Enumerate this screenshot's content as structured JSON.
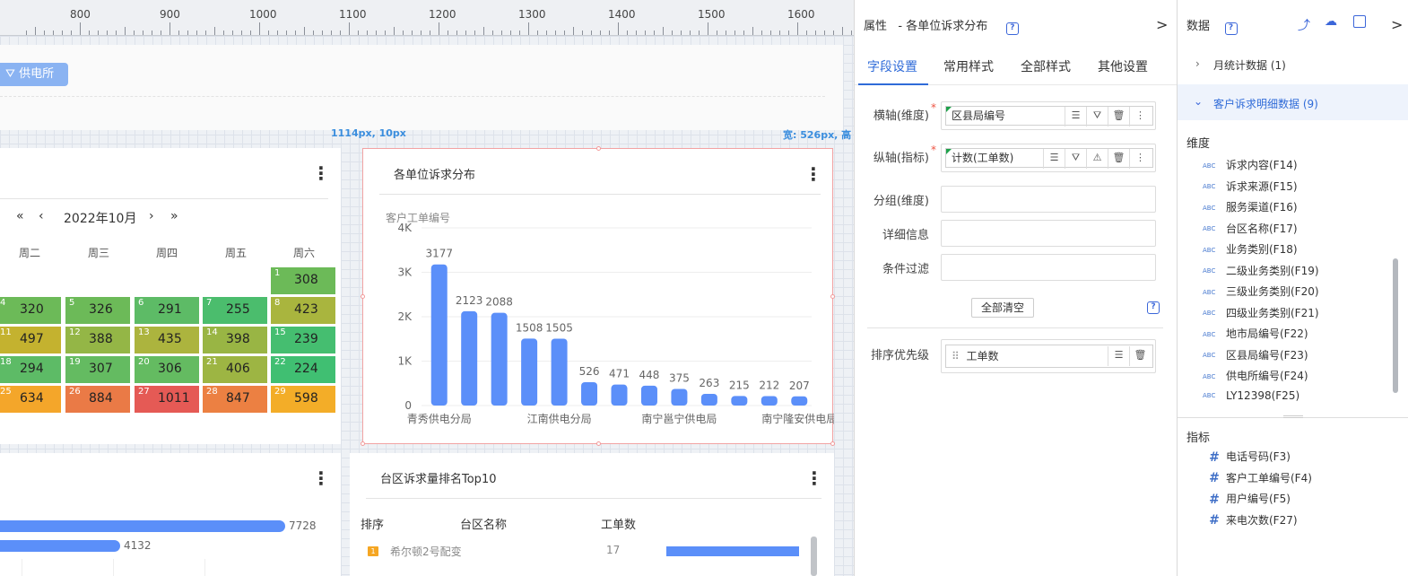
{
  "ruler": {
    "labels": [
      "800",
      "900",
      "1000",
      "1100",
      "1200",
      "1300",
      "1400",
      "1500",
      "1600"
    ]
  },
  "filterbar": {
    "button_label": "供电所"
  },
  "coords": {
    "position": "1114px, 10px",
    "width": "宽: 526px, 高"
  },
  "calendar": {
    "month": "2022年10月",
    "nav": {
      "prev_year": "«",
      "prev_month": "‹",
      "next_month": "›",
      "next_year": "»"
    },
    "weekdays": [
      "周二",
      "周三",
      "周四",
      "周五",
      "周六"
    ],
    "cells": [
      {
        "day": "1",
        "value": "308",
        "color": "#6cba58"
      },
      {
        "day": "4",
        "value": "320",
        "color": "#6cba58"
      },
      {
        "day": "5",
        "value": "326",
        "color": "#6cba58"
      },
      {
        "day": "6",
        "value": "291",
        "color": "#5dbb66"
      },
      {
        "day": "7",
        "value": "255",
        "color": "#4bbd6d"
      },
      {
        "day": "8",
        "value": "423",
        "color": "#a9b53e"
      },
      {
        "day": "11",
        "value": "497",
        "color": "#c4b22f"
      },
      {
        "day": "12",
        "value": "388",
        "color": "#94b646"
      },
      {
        "day": "13",
        "value": "435",
        "color": "#acb43e"
      },
      {
        "day": "14",
        "value": "398",
        "color": "#99b544"
      },
      {
        "day": "15",
        "value": "239",
        "color": "#45be70"
      },
      {
        "day": "18",
        "value": "294",
        "color": "#5dbb66"
      },
      {
        "day": "19",
        "value": "307",
        "color": "#64bb61"
      },
      {
        "day": "20",
        "value": "306",
        "color": "#64bb61"
      },
      {
        "day": "21",
        "value": "406",
        "color": "#9db543"
      },
      {
        "day": "22",
        "value": "224",
        "color": "#40bf72"
      },
      {
        "day": "25",
        "value": "634",
        "color": "#f4a62a"
      },
      {
        "day": "26",
        "value": "884",
        "color": "#ea7a46"
      },
      {
        "day": "27",
        "value": "1011",
        "color": "#e55a55"
      },
      {
        "day": "28",
        "value": "847",
        "color": "#ec8042"
      },
      {
        "day": "29",
        "value": "598",
        "color": "#f3ad28"
      }
    ]
  },
  "bar_card": {
    "title": "各单位诉求分布",
    "legend": "客户工单编号",
    "kebab": "⋮"
  },
  "chart_data": {
    "type": "bar",
    "title": "各单位诉求分布",
    "ylabel": "客户工单编号",
    "ylim": [
      0,
      4000
    ],
    "yticks": [
      "0",
      "1K",
      "2K",
      "3K",
      "4K"
    ],
    "values": [
      3177,
      2123,
      2088,
      1508,
      1505,
      526,
      471,
      448,
      375,
      263,
      215,
      212,
      207
    ],
    "xtick_labels": [
      "青秀供电分局",
      "江南供电分局",
      "南宁邕宁供电局",
      "南宁隆安供电局"
    ],
    "xtick_indices": [
      0,
      4,
      8,
      12
    ],
    "color": "#5b8ff9"
  },
  "bottom_left": {
    "bars": [
      {
        "value": "7728"
      },
      {
        "value": "4132"
      }
    ]
  },
  "top10": {
    "title": "台区诉求量排名Top10",
    "headers": [
      "排序",
      "台区名称",
      "工单数"
    ],
    "rows": [
      {
        "rank": "1",
        "name": "希尔顿2号配变",
        "count": "17",
        "ratio": 1.0
      }
    ]
  },
  "props": {
    "header": "属性",
    "subtitle": "- 各单位诉求分布",
    "help": "?",
    "collapse": ">",
    "tabs": [
      "字段设置",
      "常用样式",
      "全部样式",
      "其他设置"
    ],
    "fields": {
      "x_label": "横轴(维度)",
      "x_value": "区县局编号",
      "y_label": "纵轴(指标)",
      "y_value": "计数(工单数)",
      "group_label": "分组(维度)",
      "detail_label": "详细信息",
      "filter_label": "条件过滤",
      "clear_all": "全部清空",
      "sort_label": "排序优先级",
      "sort_value": "工单数"
    }
  },
  "data_panel": {
    "header": "数据",
    "help": "?",
    "collapse": ">",
    "groups": [
      {
        "label": "月统计数据 (1)",
        "expanded": false
      },
      {
        "label": "客户诉求明细数据 (9)",
        "expanded": true
      }
    ],
    "dim_title": "维度",
    "dimensions": [
      "诉求内容(F14)",
      "诉求来源(F15)",
      "服务渠道(F16)",
      "台区名称(F17)",
      "业务类别(F18)",
      "二级业务类别(F19)",
      "三级业务类别(F20)",
      "四级业务类别(F21)",
      "地市局编号(F22)",
      "区县局编号(F23)",
      "供电所编号(F24)",
      "LY12398(F25)"
    ],
    "abc": "ABC",
    "metric_title": "指标",
    "metrics": [
      "电话号码(F3)",
      "客户工单编号(F4)",
      "用户编号(F5)",
      "来电次数(F27)"
    ],
    "hash": "#"
  }
}
